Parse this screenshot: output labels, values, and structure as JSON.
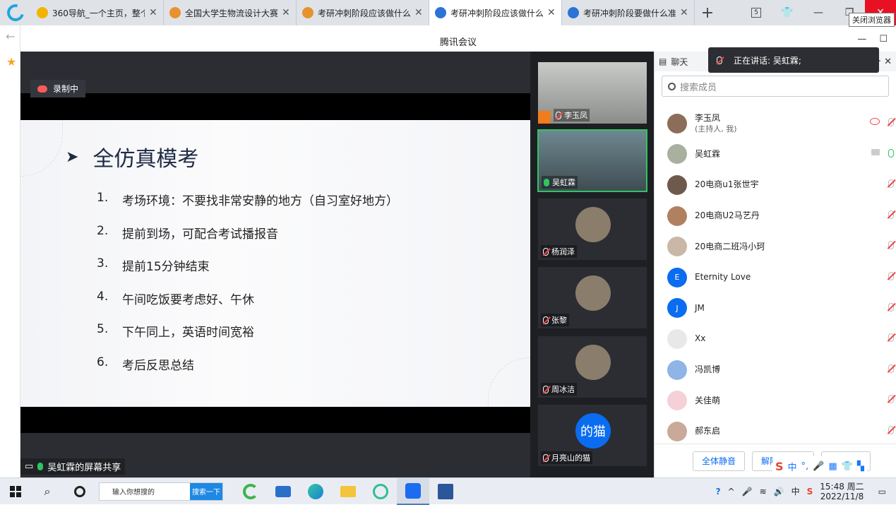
{
  "browser": {
    "tabs": [
      {
        "title": "360导航_一个主页，整个",
        "favicon_color": "#f3b400",
        "active": false
      },
      {
        "title": "全国大学生物流设计大赛",
        "favicon_color": "#e8912f",
        "active": false
      },
      {
        "title": "考研冲刺阶段应该做什么",
        "favicon_color": "#e8912f",
        "active": false
      },
      {
        "title": "考研冲刺阶段应该做什么",
        "favicon_color": "#2b73d6",
        "active": true
      },
      {
        "title": "考研冲刺阶段要做什么准",
        "favicon_color": "#2b73d6",
        "active": false
      }
    ],
    "tab_count_badge": "5",
    "close_tooltip": "关闭浏览器"
  },
  "meeting": {
    "window_title": "腾讯会议",
    "recording_label": "录制中",
    "sharer_label": "吴虹霖的屏幕共享",
    "slide": {
      "heading": "全仿真模考",
      "items": [
        {
          "num": "1.",
          "text": "考场环境：不要找非常安静的地方（自习室好地方）"
        },
        {
          "num": "2.",
          "text": "提前到场，可配合考试播报音"
        },
        {
          "num": "3.",
          "text": "提前15分钟结束"
        },
        {
          "num": "4.",
          "text": "午间吃饭要考虑好、午休"
        },
        {
          "num": "5.",
          "text": "下午同上，英语时间宽裕"
        },
        {
          "num": "6.",
          "text": "考后反思总结"
        }
      ]
    },
    "video_tiles": [
      {
        "name": "李玉凤",
        "mic": "muted",
        "video": true
      },
      {
        "name": "吴虹霖",
        "mic": "on",
        "video": true
      },
      {
        "name": "杨润泽",
        "mic": "muted",
        "video": false
      },
      {
        "name": "张黎",
        "mic": "muted",
        "video": false
      },
      {
        "name": "周冰洁",
        "mic": "muted",
        "video": false
      },
      {
        "name": "月亮山的猫",
        "mic": "muted",
        "video": false,
        "avatar_text": "的猫"
      }
    ]
  },
  "panel": {
    "chat_tab": "聊天",
    "speaking_prefix": "正在讲话: 吴虹霖;",
    "search_placeholder": "搜索成员",
    "members": [
      {
        "name": "李玉凤",
        "sub": "(主持人, 我)",
        "avatar": "",
        "mic": "muted"
      },
      {
        "name": "吴虹霖",
        "sub": "",
        "avatar": "",
        "mic": "on"
      },
      {
        "name": "20电商u1张世宇",
        "sub": "",
        "avatar": "",
        "mic": "muted"
      },
      {
        "name": "20电商U2马艺丹",
        "sub": "",
        "avatar": "",
        "mic": "muted"
      },
      {
        "name": "20电商二班冯小珂",
        "sub": "",
        "avatar": "",
        "mic": "muted"
      },
      {
        "name": "Eternity Love",
        "sub": "",
        "avatar": "E",
        "mic": "muted"
      },
      {
        "name": "JM",
        "sub": "",
        "avatar": "J",
        "mic": "muted"
      },
      {
        "name": "Xx",
        "sub": "",
        "avatar": "",
        "mic": "muted"
      },
      {
        "name": "冯凯博",
        "sub": "",
        "avatar": "",
        "mic": "muted"
      },
      {
        "name": "关佳萌",
        "sub": "",
        "avatar": "",
        "mic": "muted"
      },
      {
        "name": "郝东启",
        "sub": "",
        "avatar": "",
        "mic": "muted"
      }
    ],
    "mute_all": "全体静音",
    "unmute_all": "解除全体静音",
    "more": "更多"
  },
  "ime": {
    "lang": "中",
    "punct": "°,"
  },
  "taskbar": {
    "search_placeholder": "输入你想搜的",
    "search_button": "搜索一下",
    "ime_tray": "中",
    "time": "15:48 周二",
    "date": "2022/11/8"
  }
}
